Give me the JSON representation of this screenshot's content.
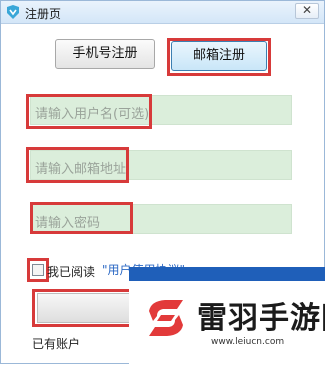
{
  "window": {
    "title": "注册页",
    "close_glyph": "✕"
  },
  "tabs": {
    "phone_label": "手机号注册",
    "email_label": "邮箱注册"
  },
  "form": {
    "username_placeholder": "请输入用户名(可选)",
    "email_placeholder": "请输入邮箱地址",
    "password_placeholder": "请输入密码",
    "agree_text": "我已阅读",
    "agreement_link": "\"用户使用协议\"",
    "agree_checked": false
  },
  "footer": {
    "login_prompt": "已有账户"
  },
  "watermark": {
    "title": "雷羽手游网",
    "url": "www.leiucn.com"
  },
  "colors": {
    "highlight": "#d73a3a",
    "field_bg": "#dbeedb",
    "link": "#2b68c4",
    "watermark_blue": "#1f5fb9"
  }
}
